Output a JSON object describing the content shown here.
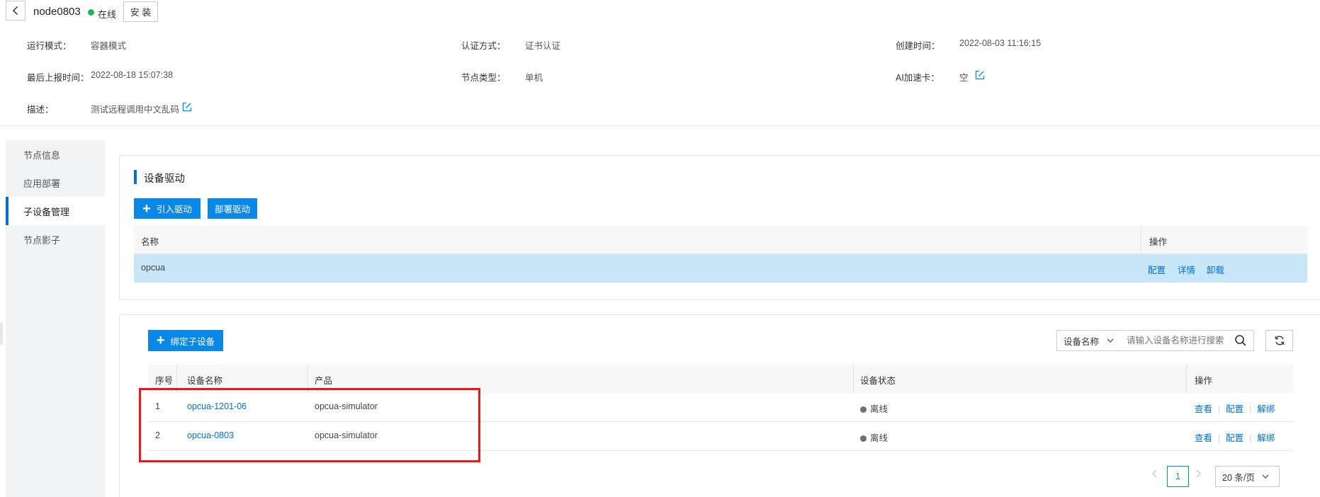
{
  "header": {
    "node_name": "node0803",
    "status_text": "在线",
    "status_color": "#22b35e",
    "install_label": "安 装"
  },
  "info": {
    "run_mode_label": "运行模式：",
    "run_mode_value": "容器模式",
    "auth_label": "认证方式：",
    "auth_value": "证书认证",
    "created_label": "创建时间：",
    "created_value": "2022-08-03 11:16:15",
    "last_report_label": "最后上报时间：",
    "last_report_value": "2022-08-18 15:07:38",
    "node_type_label": "节点类型：",
    "node_type_value": "单机",
    "ai_card_label": "AI加速卡：",
    "ai_card_value": "空",
    "desc_label": "描述：",
    "desc_value": "测试远程调用中文乱码"
  },
  "sidebar": {
    "items": [
      {
        "label": "节点信息"
      },
      {
        "label": "应用部署"
      },
      {
        "label": "子设备管理"
      },
      {
        "label": "节点影子"
      }
    ]
  },
  "driver": {
    "title": "设备驱动",
    "import_label": "引入驱动",
    "deploy_label": "部署驱动",
    "columns": {
      "name": "名称",
      "ops": "操作"
    },
    "rows": [
      {
        "name": "opcua",
        "ops": [
          "配置",
          "详情",
          "卸载"
        ]
      }
    ]
  },
  "devices": {
    "bind_label": "绑定子设备",
    "search_field": "设备名称",
    "search_placeholder": "请输入设备名称进行搜索",
    "columns": {
      "index": "序号",
      "name": "设备名称",
      "product": "产品",
      "status": "设备状态",
      "ops": "操作"
    },
    "rows": [
      {
        "index": "1",
        "name": "opcua-1201-06",
        "product": "opcua-simulator",
        "status": "离线",
        "ops": [
          "查看",
          "配置",
          "解绑"
        ]
      },
      {
        "index": "2",
        "name": "opcua-0803",
        "product": "opcua-simulator",
        "status": "离线",
        "ops": [
          "查看",
          "配置",
          "解绑"
        ]
      }
    ]
  },
  "pagination": {
    "current_page": "1",
    "page_size": "20 条/页"
  },
  "colors": {
    "accent": "#0a88e8",
    "link": "#0070cc",
    "highlight_row": "#c7e6f8",
    "annotation_box": "#e8191c",
    "offline_dot": "#6f6f6f"
  }
}
